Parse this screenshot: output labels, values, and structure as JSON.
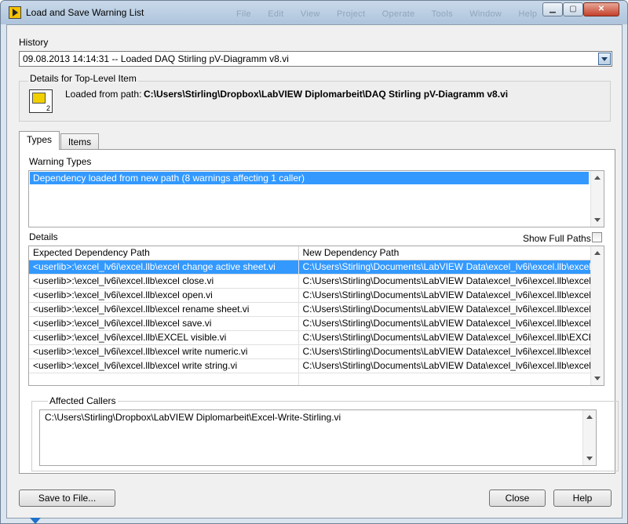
{
  "window": {
    "title": "Load and Save Warning List",
    "menu_ghost": "File Edit View Project Operate Tools Window Help",
    "controls": {
      "minimize": "▁",
      "maximize": "▢",
      "close": "✕"
    }
  },
  "history": {
    "label": "History",
    "selected": "09.08.2013 14:14:31 -- Loaded DAQ Stirling pV-Diagramm v8.vi"
  },
  "details_top": {
    "label": "Details for Top-Level Item",
    "loaded_from_label": "Loaded from path:",
    "path": "C:\\Users\\Stirling\\Dropbox\\LabVIEW Diplomarbeit\\DAQ Stirling pV-Diagramm v8.vi",
    "icon_number": "2"
  },
  "tabs": [
    {
      "label": "Types",
      "active": true
    },
    {
      "label": "Items",
      "active": false
    }
  ],
  "warning_types": {
    "label": "Warning Types",
    "items": [
      "Dependency loaded from new path (8 warnings affecting 1 caller)"
    ]
  },
  "details": {
    "label": "Details",
    "show_full_paths_label": "Show Full Paths",
    "columns": [
      "Expected Dependency Path",
      "New Dependency Path"
    ],
    "rows": [
      [
        "<userlib>:\\excel_lv6i\\excel.llb\\excel change active sheet.vi",
        "C:\\Users\\Stirling\\Documents\\LabVIEW Data\\excel_lv6i\\excel.llb\\excel"
      ],
      [
        "<userlib>:\\excel_lv6i\\excel.llb\\excel close.vi",
        "C:\\Users\\Stirling\\Documents\\LabVIEW Data\\excel_lv6i\\excel.llb\\excel"
      ],
      [
        "<userlib>:\\excel_lv6i\\excel.llb\\excel open.vi",
        "C:\\Users\\Stirling\\Documents\\LabVIEW Data\\excel_lv6i\\excel.llb\\excel"
      ],
      [
        "<userlib>:\\excel_lv6i\\excel.llb\\excel rename sheet.vi",
        "C:\\Users\\Stirling\\Documents\\LabVIEW Data\\excel_lv6i\\excel.llb\\excel"
      ],
      [
        "<userlib>:\\excel_lv6i\\excel.llb\\excel save.vi",
        "C:\\Users\\Stirling\\Documents\\LabVIEW Data\\excel_lv6i\\excel.llb\\excel"
      ],
      [
        "<userlib>:\\excel_lv6i\\excel.llb\\EXCEL visible.vi",
        "C:\\Users\\Stirling\\Documents\\LabVIEW Data\\excel_lv6i\\excel.llb\\EXCE"
      ],
      [
        "<userlib>:\\excel_lv6i\\excel.llb\\excel write numeric.vi",
        "C:\\Users\\Stirling\\Documents\\LabVIEW Data\\excel_lv6i\\excel.llb\\excel"
      ],
      [
        "<userlib>:\\excel_lv6i\\excel.llb\\excel write string.vi",
        "C:\\Users\\Stirling\\Documents\\LabVIEW Data\\excel_lv6i\\excel.llb\\excel"
      ]
    ]
  },
  "affected_callers": {
    "label": "Affected Callers",
    "items": [
      "C:\\Users\\Stirling\\Dropbox\\LabVIEW Diplomarbeit\\Excel-Write-Stirling.vi"
    ]
  },
  "buttons": {
    "save": "Save to File...",
    "close": "Close",
    "help": "Help"
  }
}
